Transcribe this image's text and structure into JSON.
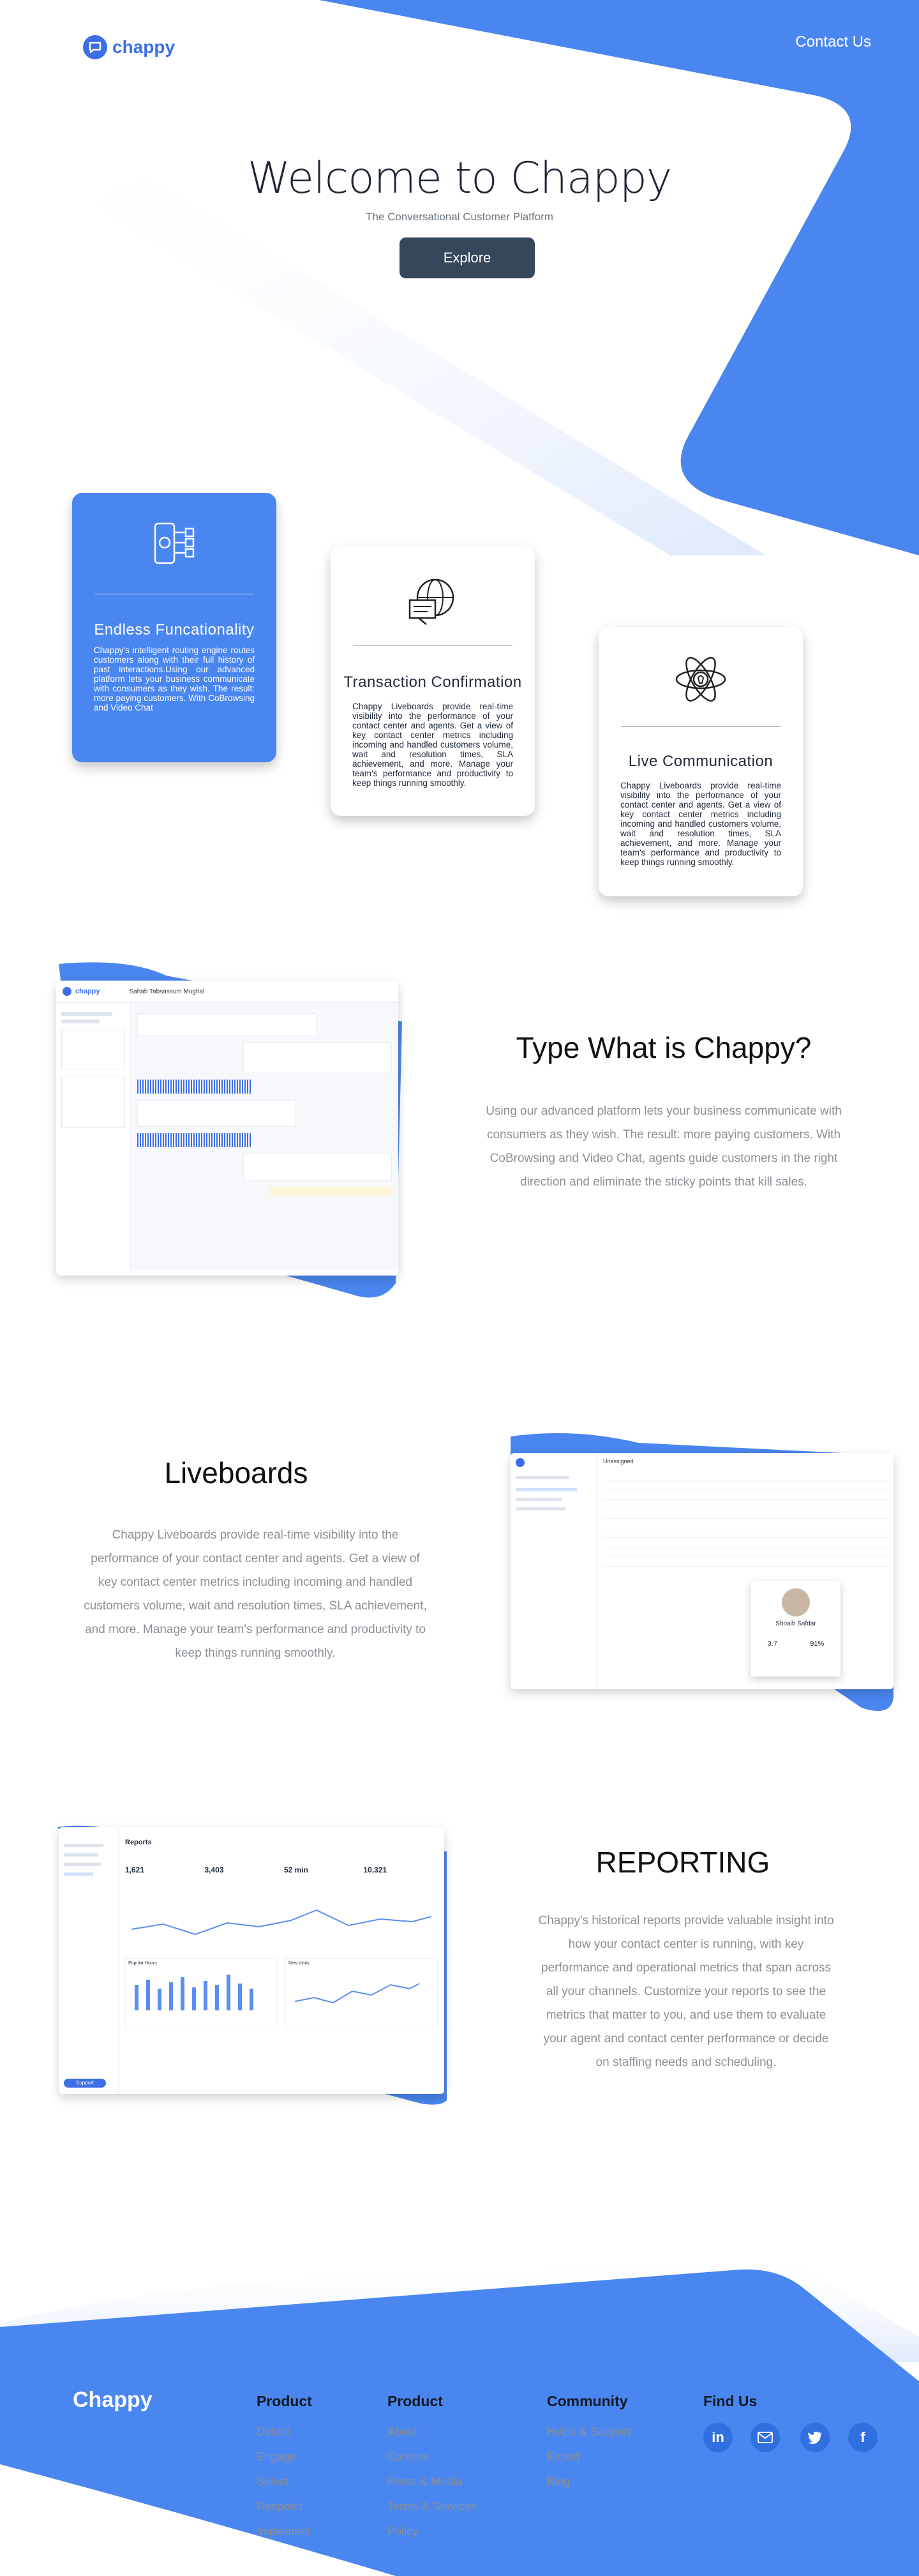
{
  "brand": {
    "logo_text": "chappy",
    "accent": "#4a86ef",
    "dark_button": "#35475a"
  },
  "nav": {
    "contact": "Contact Us"
  },
  "hero": {
    "title": "Welcome to Chappy",
    "subtitle": "The Conversational Customer Platform",
    "cta": "Explore"
  },
  "features": [
    {
      "icon": "phone-network-icon",
      "title": "Endless Funcationality",
      "body": "Chappy's intelligent routing engine routes customers along with their full history of past interactions.Using our advanced platform lets your business communicate with consumers as they wish.  The result: more paying customers. With CoBrowsing and Video Chat"
    },
    {
      "icon": "globe-monitor-icon",
      "title": "Transaction Confirmation",
      "body": "Chappy Liveboards provide real-time visibility into the performance of your contact center and agents. Get a view of key contact center metrics including incoming and handled customers volume, wait and resolution times, SLA achievement, and more. Manage your team's performance and productivity to keep things running smoothly."
    },
    {
      "icon": "atom-lightbulb-icon",
      "title": "Live Communication",
      "body": "Chappy Liveboards provide real-time visibility into the performance of your contact center and agents. Get a view of key contact center metrics including incoming and handled customers volume, wait and resolution times, SLA achievement, and more. Manage your team's performance and productivity to keep things running smoothly."
    }
  ],
  "section_type": {
    "title": "Type What is Chappy?",
    "body": "Using our advanced platform lets your business communicate with consumers as they wish. The result: more paying customers. With CoBrowsing and Video Chat, agents guide customers in the right direction and eliminate the sticky points that kill sales.",
    "screenshot": {
      "app_name": "chappy",
      "user_name": "Sahab Tabsassum Mughal"
    }
  },
  "section_liveboards": {
    "title": "Liveboards",
    "body": "Chappy Liveboards provide real-time visibility into the performance of your contact center and agents. Get a view of key contact center metrics including incoming and handled customers volume, wait and resolution times, SLA achievement, and more. Manage your team's performance and productivity to keep things running smoothly.",
    "screenshot": {
      "header": "Unassigned",
      "profile_name": "Shoaib Safdar",
      "stat_a": "3.7",
      "stat_b": "91%"
    }
  },
  "section_reporting": {
    "title": "REPORTING",
    "body": "Chappy's historical reports provide valuable insight into how your contact center is running, with key performance and operational metrics that span across all your channels. Customize your reports to see the metrics that matter to you, and use them to evaluate your agent and contact center performance or decide on staffing needs and scheduling.",
    "screenshot": {
      "title": "Reports",
      "metrics": [
        "1,621",
        "3,403",
        "52 min",
        "10,321"
      ],
      "panels": [
        "Popular Hours",
        "New Visits"
      ],
      "sidebar_button": "Support"
    }
  },
  "footer": {
    "brand": "Chappy",
    "columns": [
      {
        "heading": "Product",
        "links": [
          "Detect",
          "Engage",
          "Select",
          "Respond",
          "Implement"
        ]
      },
      {
        "heading": "Product",
        "links": [
          "About",
          "Careers",
          "Press & Media",
          "Terms & Services",
          "Policy"
        ]
      },
      {
        "heading": "Community",
        "links": [
          "Helps & Support",
          "Expert",
          "Blog"
        ]
      }
    ],
    "find_us": "Find Us",
    "social": [
      "linkedin-icon",
      "mail-icon",
      "twitter-icon",
      "facebook-icon"
    ]
  }
}
